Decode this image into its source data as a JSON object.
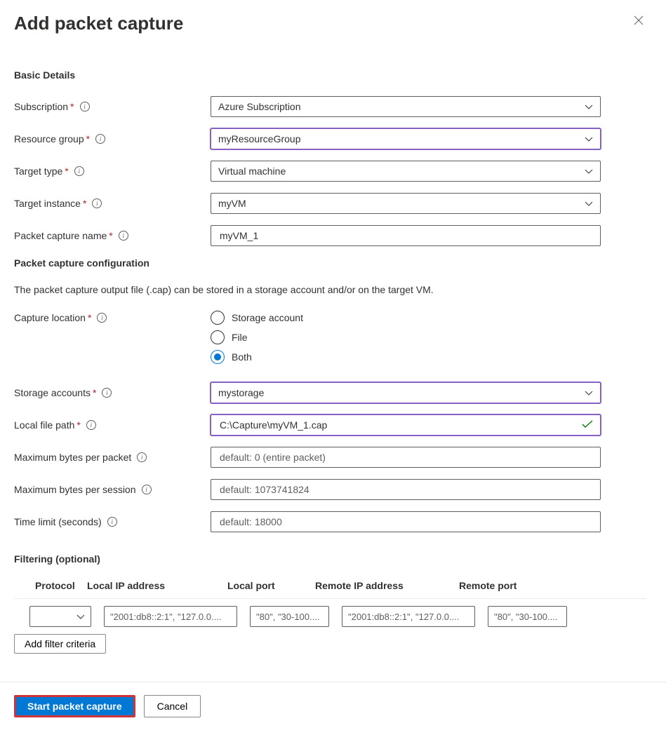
{
  "header": {
    "title": "Add packet capture"
  },
  "sections": {
    "basic": "Basic Details",
    "config": "Packet capture configuration",
    "config_note": "The packet capture output file (.cap) can be stored in a storage account and/or on the target VM.",
    "filtering": "Filtering (optional)"
  },
  "fields": {
    "subscription": {
      "label": "Subscription",
      "value": "Azure Subscription"
    },
    "resource_group": {
      "label": "Resource group",
      "value": "myResourceGroup"
    },
    "target_type": {
      "label": "Target type",
      "value": "Virtual machine"
    },
    "target_instance": {
      "label": "Target instance",
      "value": "myVM"
    },
    "capture_name": {
      "label": "Packet capture name",
      "value": "myVM_1"
    },
    "capture_location": {
      "label": "Capture location",
      "options": {
        "storage": "Storage account",
        "file": "File",
        "both": "Both"
      },
      "selected": "both"
    },
    "storage_accounts": {
      "label": "Storage accounts",
      "value": "mystorage"
    },
    "local_file_path": {
      "label": "Local file path",
      "value": "C:\\Capture\\myVM_1.cap"
    },
    "max_bytes_packet": {
      "label": "Maximum bytes per packet",
      "placeholder": "default: 0 (entire packet)"
    },
    "max_bytes_session": {
      "label": "Maximum bytes per session",
      "placeholder": "default: 1073741824"
    },
    "time_limit": {
      "label": "Time limit (seconds)",
      "placeholder": "default: 18000"
    }
  },
  "filters": {
    "headers": {
      "protocol": "Protocol",
      "local_ip": "Local IP address",
      "local_port": "Local port",
      "remote_ip": "Remote IP address",
      "remote_port": "Remote port"
    },
    "row": {
      "local_ip_ph": "\"2001:db8::2:1\", \"127.0.0....",
      "local_port_ph": "\"80\", \"30-100....",
      "remote_ip_ph": "\"2001:db8::2:1\", \"127.0.0....",
      "remote_port_ph": "\"80\", \"30-100...."
    },
    "add_button": "Add filter criteria"
  },
  "footer": {
    "start": "Start packet capture",
    "cancel": "Cancel"
  }
}
